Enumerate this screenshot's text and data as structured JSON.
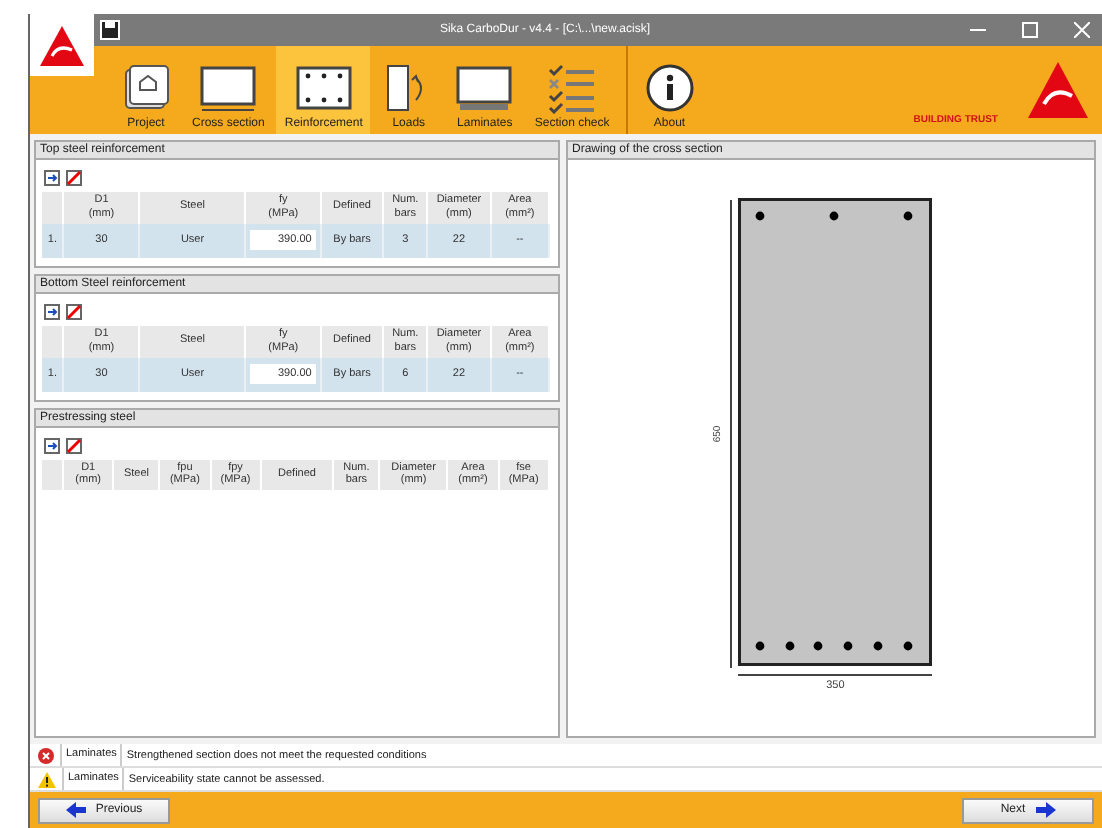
{
  "window": {
    "title": "Sika CarboDur - v4.4 - [C:\\...\\new.acisk]"
  },
  "ribbon": [
    {
      "kind": "project",
      "label": "Project",
      "selected": false
    },
    {
      "kind": "cross",
      "label": "Cross section",
      "selected": false
    },
    {
      "kind": "reinforcement",
      "label": "Reinforcement",
      "selected": true
    },
    {
      "kind": "loads",
      "label": "Loads",
      "selected": false
    },
    {
      "kind": "laminates",
      "label": "Laminates",
      "selected": false
    },
    {
      "kind": "check",
      "label": "Section check",
      "selected": false
    },
    {
      "kind": "about",
      "label": "About",
      "selected": false
    }
  ],
  "brand": {
    "slogan": "BUILDING TRUST"
  },
  "steel_panels": [
    {
      "title": "Top steel reinforcement",
      "columns": [
        {
          "label": "D1",
          "unit": "(mm)"
        },
        {
          "label": "Steel"
        },
        {
          "label": "fy",
          "unit": "(MPa)"
        },
        {
          "label": "Defined"
        },
        {
          "label": "Num.",
          "unit": "bars"
        },
        {
          "label": "Diameter",
          "unit": "(mm)"
        },
        {
          "label": "Area",
          "unit": "(mm²)"
        }
      ],
      "rows": [
        {
          "index": "1.",
          "cells": [
            "30",
            "User",
            "390.00",
            "By bars",
            "3",
            "22",
            "--"
          ]
        }
      ]
    },
    {
      "title": "Bottom Steel reinforcement",
      "columns": [
        {
          "label": "D1",
          "unit": "(mm)"
        },
        {
          "label": "Steel"
        },
        {
          "label": "fy",
          "unit": "(MPa)"
        },
        {
          "label": "Defined"
        },
        {
          "label": "Num.",
          "unit": "bars"
        },
        {
          "label": "Diameter",
          "unit": "(mm)"
        },
        {
          "label": "Area",
          "unit": "(mm²)"
        }
      ],
      "rows": [
        {
          "index": "1.",
          "cells": [
            "30",
            "User",
            "390.00",
            "By bars",
            "6",
            "22",
            "--"
          ]
        }
      ]
    }
  ],
  "prestressing": {
    "title": "Prestressing steel",
    "columns": [
      {
        "label": "D1",
        "unit": "(mm)"
      },
      {
        "label": "Steel"
      },
      {
        "label": "fpu",
        "unit": "(MPa)"
      },
      {
        "label": "fpy",
        "unit": "(MPa)"
      },
      {
        "label": "Defined"
      },
      {
        "label": "Num.",
        "unit": "bars"
      },
      {
        "label": "Diameter",
        "unit": "(mm)"
      },
      {
        "label": "Area",
        "unit": "(mm²)"
      },
      {
        "label": "fse",
        "unit": "(MPa)"
      }
    ]
  },
  "drawing": {
    "title": "Drawing of the cross section",
    "height_label": "650",
    "width_label": "350"
  },
  "messages": [
    {
      "kind": "error",
      "source": "Laminates",
      "text": "Strengthened section does not meet the requested conditions"
    },
    {
      "kind": "warning",
      "source": "Laminates",
      "text": "Serviceability state cannot be assessed."
    }
  ],
  "footer": {
    "previous": "Previous",
    "next": "Next"
  }
}
